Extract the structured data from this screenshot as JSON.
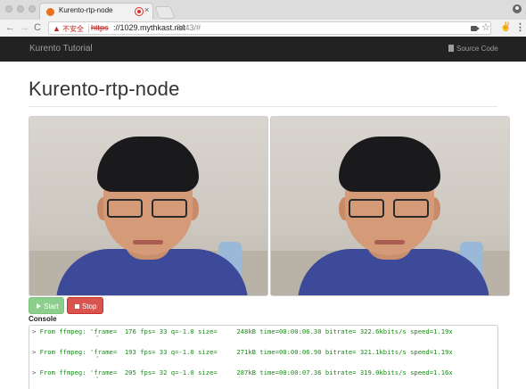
{
  "browser": {
    "tab_title": "Kurento-rtp-node",
    "tab_close": "×",
    "back": "←",
    "forward": "→",
    "reload": "C",
    "insecure_label": "不安全",
    "warning_glyph": "▲",
    "url_scheme": "https",
    "url_host": "://1029.mythkast.net",
    "url_rest": ":8443/#",
    "star": "☆",
    "menu": "⋮",
    "extension": "✌"
  },
  "navbar": {
    "brand": "Kurento Tutorial",
    "source_code": "Source Code"
  },
  "page": {
    "title": "Kurento-rtp-node"
  },
  "buttons": {
    "start": "Start",
    "stop": "Stop"
  },
  "console": {
    "label": "Console",
    "prompt": ">",
    "tick": "'",
    "lines": [
      "From ffmpeg: 'frame=  176 fps= 33 q=-1.0 size=     248kB time=00:00:06.30 bitrate= 322.6kbits/s speed=1.19x",
      "From ffmpeg: 'frame=  193 fps= 33 q=-1.0 size=     271kB time=00:00:06.90 bitrate= 321.1kbits/s speed=1.19x",
      "From ffmpeg: 'frame=  205 fps= 32 q=-1.0 size=     287kB time=00:00:07.36 bitrate= 319.0kbits/s speed=1.16x"
    ]
  },
  "colors": {
    "navbar_bg": "#222222",
    "start_button": "#8ccf8c",
    "stop_button": "#d9534f",
    "console_text": "#1a8a1a"
  }
}
